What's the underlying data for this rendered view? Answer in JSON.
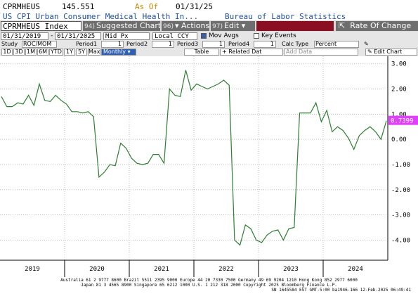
{
  "header": {
    "ticker": "CPRMHEUS",
    "price": "145.551",
    "as_of_label": "As Of",
    "as_of_date": "01/31/25",
    "description": "US CPI Urban Consumer Medical Health In...",
    "source": "Bureau of Labor Statistics"
  },
  "toolbar": {
    "security": "CPRMHEUS Index",
    "suggested_num": "94)",
    "suggested": "Suggested Charts",
    "actions_num": "96)",
    "actions": "Actions",
    "edit_num": "97)",
    "edit": "Edit",
    "roc": "Rate Of Change",
    "start_date": "01/31/2019",
    "end_date": "01/31/2025",
    "price_type": "Mid Px",
    "currency": "Local CCY",
    "mov_avgs": "Mov Avgs",
    "key_events": "Key Events",
    "study_label": "Study",
    "study_value": "ROC/MOM",
    "period1_label": "Period1",
    "period1_value": "1",
    "period2_label": "Period2",
    "period2_value": "1",
    "period3_label": "Period3",
    "period3_value": "1",
    "period4_label": "Period4",
    "period4_value": "1",
    "calc_type_label": "Calc Type",
    "calc_type_value": "Percent",
    "periods": [
      "1D",
      "3D",
      "1M",
      "6M",
      "YTD",
      "1Y",
      "5Y",
      "Max"
    ],
    "frequency": "Monthly",
    "table": "Table",
    "related": "Related Dat",
    "add_data": "Add Data",
    "edit_chart": "Edit Chart"
  },
  "chart_data": {
    "type": "line",
    "yticks": [
      "3.00",
      "2.00",
      "1.00",
      "0.00",
      "-1.00",
      "-2.00",
      "-3.00",
      "-4.00"
    ],
    "ylim": [
      -4.8,
      3.3
    ],
    "xlabels": [
      "2019",
      "2020",
      "2021",
      "2022",
      "2023",
      "2024"
    ],
    "last_value_label": "0.7399",
    "line_color": "#2e7d32",
    "label_color": "#e040fb",
    "series": [
      {
        "values": [
          1.7,
          1.3,
          1.3,
          1.45,
          1.4,
          1.75,
          1.35,
          2.2,
          1.55,
          1.5,
          1.75,
          1.55,
          1.4,
          1.1,
          1.1,
          1.05,
          1.1,
          0.9,
          -1.5,
          -1.3,
          -1.0,
          -1.05,
          -0.15,
          -0.35,
          -0.75,
          -0.95,
          -1.0,
          -0.95,
          -0.6,
          -0.6,
          -0.95,
          2.0,
          1.75,
          1.7,
          2.75,
          1.95,
          2.2,
          2.1,
          2.0,
          2.1,
          2.2,
          2.35,
          2.15,
          -4.0,
          -4.2,
          -3.4,
          -3.55,
          -4.0,
          -4.1,
          -3.8,
          -3.65,
          -3.6,
          -4.0,
          -3.55,
          -3.5,
          1.05,
          1.05,
          1.05,
          1.45,
          0.7,
          1.15,
          0.3,
          0.5,
          0.35,
          0.05,
          -0.4,
          0.15,
          0.35,
          0.5,
          0.3,
          0.0,
          0.74
        ]
      }
    ]
  },
  "footer": {
    "line1": "Australia 61 2 9777 8600 Brazil 5511 2395 9000 Europe 44 20 7330 7500 Germany 49 69 9204 1210 Hong Kong 852 2977 6000",
    "line2": "Japan 81 3 4565 8900        Singapore 65 6212 1000      U.S. 1 212 318 2000              Copyright 2025 Bloomberg Finance L.P.",
    "line3": "SN 1645584 EST  GMT-5:00 ba1946-166 12-Feb-2025 06:49:41"
  }
}
